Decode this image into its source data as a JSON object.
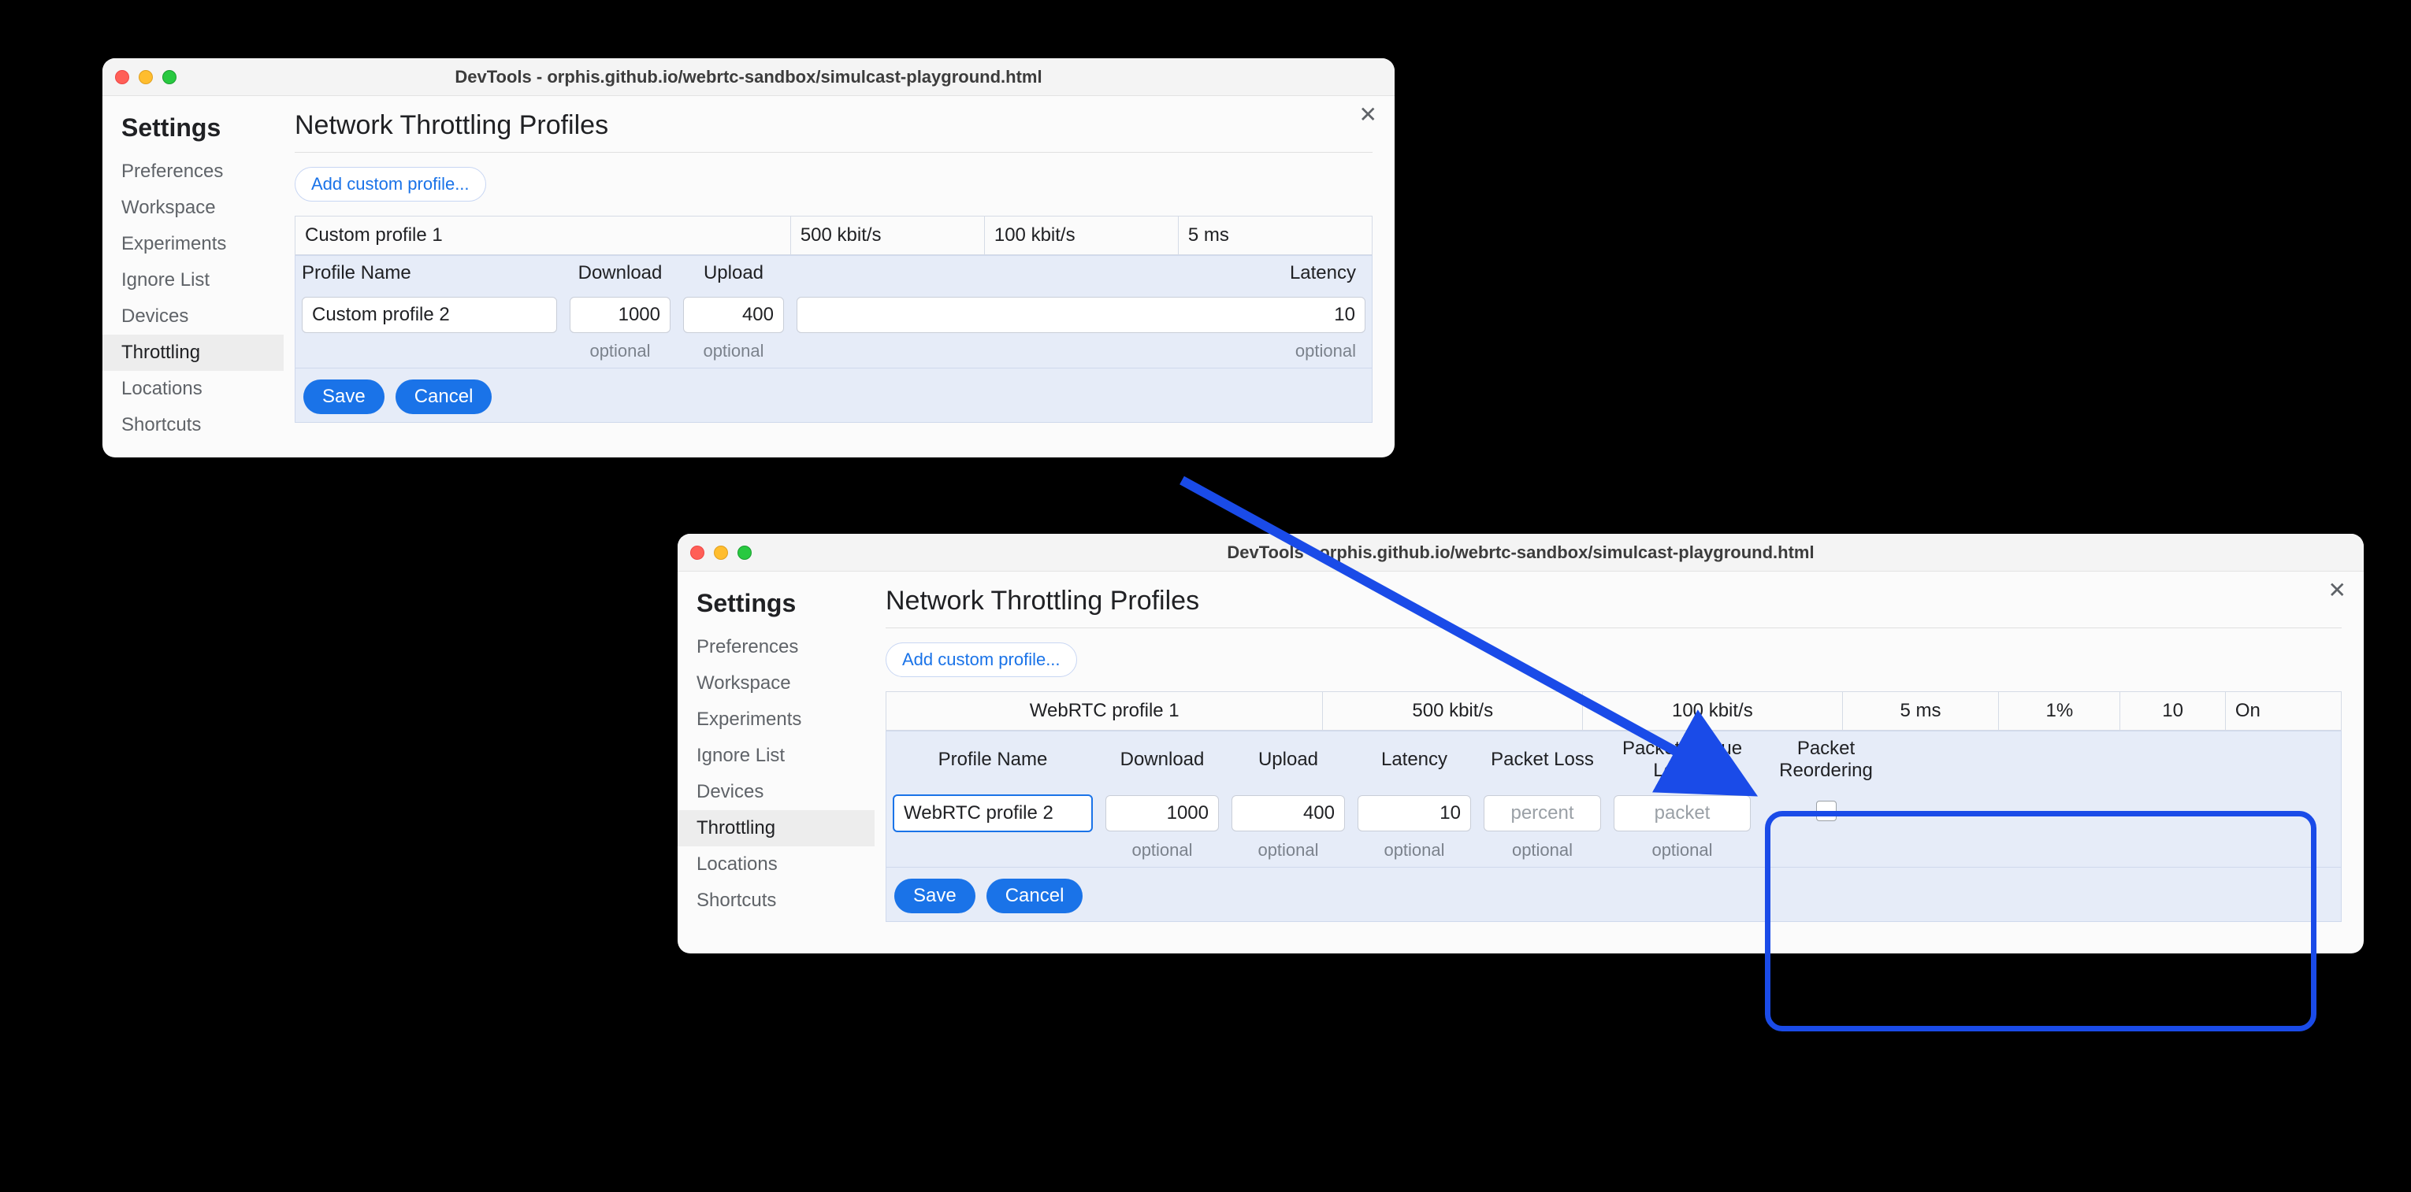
{
  "window_a": {
    "title": "DevTools - orphis.github.io/webrtc-sandbox/simulcast-playground.html",
    "sidebar_heading": "Settings",
    "sidebar": [
      "Preferences",
      "Workspace",
      "Experiments",
      "Ignore List",
      "Devices",
      "Throttling",
      "Locations",
      "Shortcuts"
    ],
    "sidebar_selected_index": 5,
    "heading": "Network Throttling Profiles",
    "add_button": "Add custom profile...",
    "existing_row": {
      "name": "Custom profile 1",
      "download": "500 kbit/s",
      "upload": "100 kbit/s",
      "latency": "5 ms"
    },
    "editor_headers": {
      "name": "Profile Name",
      "download": "Download",
      "upload": "Upload",
      "latency": "Latency"
    },
    "editor_values": {
      "name": "Custom profile 2",
      "download": "1000",
      "upload": "400",
      "latency": "10"
    },
    "hint": "optional",
    "save": "Save",
    "cancel": "Cancel"
  },
  "window_b": {
    "title": "DevTools - orphis.github.io/webrtc-sandbox/simulcast-playground.html",
    "sidebar_heading": "Settings",
    "sidebar": [
      "Preferences",
      "Workspace",
      "Experiments",
      "Ignore List",
      "Devices",
      "Throttling",
      "Locations",
      "Shortcuts"
    ],
    "sidebar_selected_index": 5,
    "heading": "Network Throttling Profiles",
    "add_button": "Add custom profile...",
    "existing_row": {
      "name": "WebRTC profile 1",
      "download": "500 kbit/s",
      "upload": "100 kbit/s",
      "latency": "5 ms",
      "loss": "1%",
      "queue": "10",
      "reorder": "On"
    },
    "editor_headers": {
      "name": "Profile Name",
      "download": "Download",
      "upload": "Upload",
      "latency": "Latency",
      "loss": "Packet Loss",
      "queue": "Packet Queue Length",
      "reorder": "Packet Reordering"
    },
    "editor_values": {
      "name": "WebRTC profile 2",
      "download": "1000",
      "upload": "400",
      "latency": "10",
      "loss": "",
      "queue": ""
    },
    "placeholders": {
      "loss": "percent",
      "queue": "packet"
    },
    "hint": "optional",
    "save": "Save",
    "cancel": "Cancel"
  }
}
